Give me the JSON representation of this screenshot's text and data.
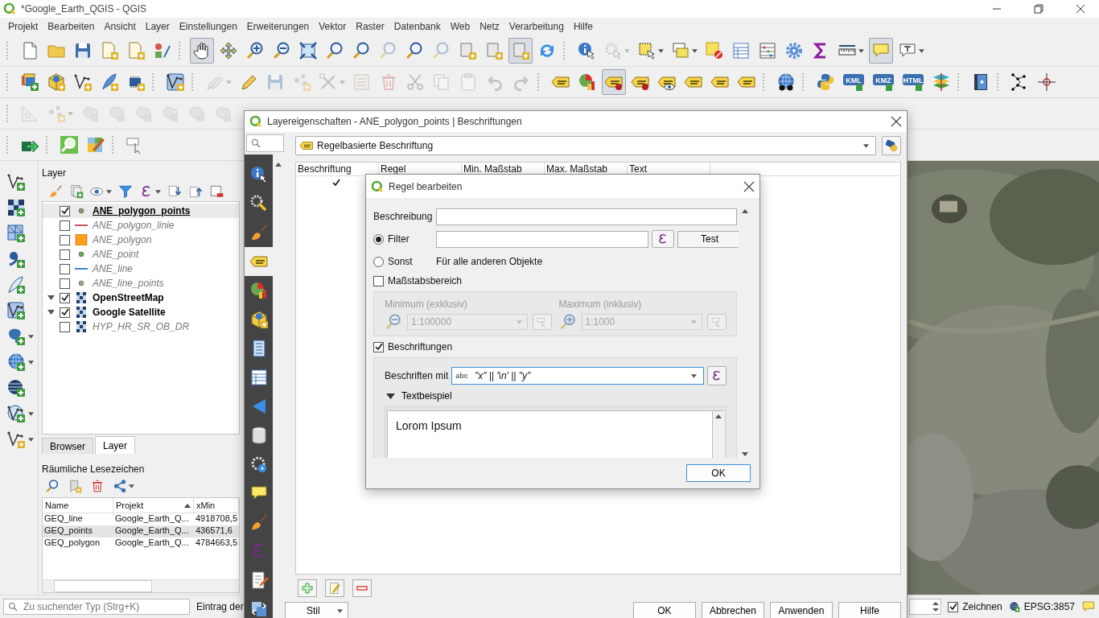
{
  "window": {
    "title": "*Google_Earth_QGIS - QGIS"
  },
  "menu": [
    "Projekt",
    "Bearbeiten",
    "Ansicht",
    "Layer",
    "Einstellungen",
    "Erweiterungen",
    "Vektor",
    "Raster",
    "Datenbank",
    "Web",
    "Netz",
    "Verarbeitung",
    "Hilfe"
  ],
  "toolbars": [
    {
      "buttons": [
        {
          "disabled": false,
          "on": false
        },
        {
          "disabled": false,
          "on": false
        },
        {
          "disabled": false,
          "on": false
        },
        {
          "disabled": false,
          "on": false
        },
        {
          "disabled": false,
          "on": false
        },
        {
          "disabled": false,
          "on": false
        },
        {
          "disabled": false,
          "on": true
        },
        {
          "disabled": false,
          "on": false
        },
        {
          "disabled": false,
          "on": false
        },
        {
          "disabled": false,
          "on": false
        },
        {
          "disabled": false,
          "on": false
        },
        {
          "disabled": false,
          "on": false
        },
        {
          "disabled": false,
          "on": false
        },
        {
          "disabled": true,
          "on": false
        },
        {
          "disabled": false,
          "on": false
        },
        {
          "disabled": true,
          "on": false
        },
        {
          "disabled": false,
          "on": false
        },
        {
          "disabled": false,
          "on": false
        },
        {
          "disabled": false,
          "on": true
        },
        {
          "disabled": false,
          "on": false
        },
        {
          "disabled": false,
          "on": false
        },
        {
          "disabled": true,
          "on": false
        },
        {
          "disabled": false,
          "on": false
        },
        {
          "disabled": false,
          "on": false
        },
        {
          "disabled": false,
          "on": false
        },
        {
          "disabled": false,
          "on": false
        },
        {
          "disabled": false,
          "on": false
        },
        {
          "disabled": false,
          "on": false
        },
        {
          "disabled": false,
          "on": false
        },
        {
          "disabled": false,
          "on": false
        },
        {
          "disabled": false,
          "on": true
        },
        {
          "disabled": false,
          "on": false
        }
      ]
    },
    {
      "buttons": [
        {
          "disabled": false,
          "on": false
        },
        {
          "disabled": false,
          "on": false
        },
        {
          "disabled": false,
          "on": false
        },
        {
          "disabled": false,
          "on": false
        },
        {
          "disabled": false,
          "on": false
        },
        {
          "disabled": false,
          "on": false
        },
        {
          "disabled": true,
          "on": false
        },
        {
          "disabled": false,
          "on": false
        },
        {
          "disabled": true,
          "on": false
        },
        {
          "disabled": true,
          "on": false
        },
        {
          "disabled": true,
          "on": false
        },
        {
          "disabled": true,
          "on": false
        },
        {
          "disabled": true,
          "on": false
        },
        {
          "disabled": true,
          "on": false
        },
        {
          "disabled": true,
          "on": false
        },
        {
          "disabled": true,
          "on": false
        },
        {
          "disabled": true,
          "on": false
        },
        {
          "disabled": true,
          "on": false
        },
        {
          "disabled": false,
          "on": false
        },
        {
          "disabled": false,
          "on": false
        },
        {
          "disabled": false,
          "on": true
        },
        {
          "disabled": false,
          "on": false
        },
        {
          "disabled": false,
          "on": false
        },
        {
          "disabled": false,
          "on": false
        },
        {
          "disabled": false,
          "on": false
        },
        {
          "disabled": false,
          "on": false
        },
        {
          "disabled": false,
          "on": false
        },
        {
          "disabled": false,
          "on": false
        },
        {
          "disabled": false,
          "on": false,
          "label": "KML"
        },
        {
          "disabled": false,
          "on": false,
          "label": "KMZ"
        },
        {
          "disabled": false,
          "on": false,
          "label": "HTML"
        },
        {
          "disabled": false,
          "on": false
        },
        {
          "disabled": false,
          "on": false
        },
        {
          "disabled": false,
          "on": false
        },
        {
          "disabled": false,
          "on": false
        }
      ]
    },
    {
      "buttons": [
        {
          "disabled": true,
          "on": false
        },
        {
          "disabled": true,
          "on": false
        },
        {
          "disabled": true,
          "on": false
        },
        {
          "disabled": true,
          "on": false
        },
        {
          "disabled": true,
          "on": false
        },
        {
          "disabled": true,
          "on": false
        },
        {
          "disabled": true,
          "on": false
        },
        {
          "disabled": true,
          "on": false
        }
      ]
    },
    {
      "buttons": [
        {
          "disabled": false,
          "on": false
        },
        {
          "disabled": false,
          "on": false
        },
        {
          "disabled": false,
          "on": false
        },
        {
          "disabled": false,
          "on": false
        }
      ]
    }
  ],
  "layers_panel": {
    "title": "Layer",
    "items": [
      {
        "name": "ANE_polygon_points",
        "checked": true,
        "selected": true,
        "symbol": {
          "kind": "point",
          "color": "#8a9a6e"
        }
      },
      {
        "name": "ANE_polygon_linie",
        "checked": false,
        "selected": false,
        "symbol": {
          "kind": "line",
          "color": "#c0555a"
        }
      },
      {
        "name": "ANE_polygon",
        "checked": false,
        "selected": false,
        "symbol": {
          "kind": "polygon",
          "color": "#ff9f1c"
        }
      },
      {
        "name": "ANE_point",
        "checked": false,
        "selected": false,
        "symbol": {
          "kind": "point",
          "color": "#6aa84f"
        }
      },
      {
        "name": "ANE_line",
        "checked": false,
        "selected": false,
        "symbol": {
          "kind": "line",
          "color": "#3d85c6"
        }
      },
      {
        "name": "ANE_line_points",
        "checked": false,
        "selected": false,
        "symbol": {
          "kind": "point",
          "color": "#a89f86"
        }
      },
      {
        "name": "OpenStreetMap",
        "checked": true,
        "selected": false,
        "expanded": true,
        "symbol": {
          "kind": "raster"
        }
      },
      {
        "name": "Google Satellite",
        "checked": true,
        "selected": false,
        "expanded": true,
        "symbol": {
          "kind": "raster"
        }
      },
      {
        "name": "HYP_HR_SR_OB_DR",
        "checked": false,
        "selected": false,
        "symbol": {
          "kind": "raster"
        }
      }
    ]
  },
  "panel_tabs": [
    {
      "label": "Browser",
      "selected": false
    },
    {
      "label": "Layer",
      "selected": true
    }
  ],
  "bookmarks": {
    "title": "Räumliche Lesezeichen",
    "columns": [
      {
        "label": "Name",
        "sorted": false
      },
      {
        "label": "Projekt",
        "sorted": true
      },
      {
        "label": "xMin",
        "sorted": false
      }
    ],
    "rows": [
      {
        "cells": [
          "GEQ_line",
          "Google_Earth_Q...",
          "4918708,5"
        ],
        "selected": false
      },
      {
        "cells": [
          "GEQ_points",
          "Google_Earth_Q...",
          "436571,6"
        ],
        "selected": true
      },
      {
        "cells": [
          "GEQ_polygon",
          "Google_Earth_Q...",
          "4784663,5"
        ],
        "selected": false
      }
    ]
  },
  "status_bar": {
    "search_placeholder": "Zu suchender Typ (Strg+K)",
    "message": "Eintrag der",
    "render": {
      "label": "Zeichnen",
      "checked": true
    },
    "crs": "EPSG:3857"
  },
  "properties_dialog": {
    "title": "Layereigenschaften - ANE_polygon_points | Beschriftungen",
    "sections": [
      {
        "selected": false
      },
      {
        "selected": false
      },
      {
        "selected": false
      },
      {
        "selected": true
      },
      {
        "selected": false
      },
      {
        "selected": false
      },
      {
        "selected": false
      },
      {
        "selected": false
      },
      {
        "selected": false
      },
      {
        "selected": false
      },
      {
        "selected": false
      },
      {
        "selected": false
      },
      {
        "selected": false
      },
      {
        "selected": false
      },
      {
        "selected": false
      },
      {
        "selected": false
      }
    ],
    "mode": "Regelbasierte Beschriftung",
    "columns": [
      "Beschriftung",
      "Regel",
      "Min. Maßstab",
      "Max. Maßstab",
      "Text"
    ],
    "rows": [
      {
        "checked": true
      }
    ],
    "style_button": "Stil",
    "buttons": [
      "OK",
      "Abbrechen",
      "Anwenden",
      "Hilfe"
    ]
  },
  "rule_dialog": {
    "title": "Regel bearbeiten",
    "description": {
      "label": "Beschreibung"
    },
    "filter": {
      "label": "Filter",
      "selected": true,
      "test": "Test"
    },
    "else": {
      "label": "Sonst",
      "selected": false,
      "hint": "Für alle anderen Objekte"
    },
    "scale": {
      "label": "Maßstabsbereich",
      "checked": false,
      "minimum": {
        "label": "Minimum (exklusiv)",
        "value": "1:100000"
      },
      "maximum": {
        "label": "Maximum (inklusiv)",
        "value": "1:1000"
      }
    },
    "labels": {
      "label": "Beschriftungen",
      "checked": true,
      "field_label": "Beschriften mit",
      "type": "abc",
      "expression": "\"x\" || '\\n' || \"y\""
    },
    "sample": {
      "label": "Textbeispiel",
      "expanded": true,
      "text": "Lorom Ipsum"
    },
    "ok": "OK"
  }
}
